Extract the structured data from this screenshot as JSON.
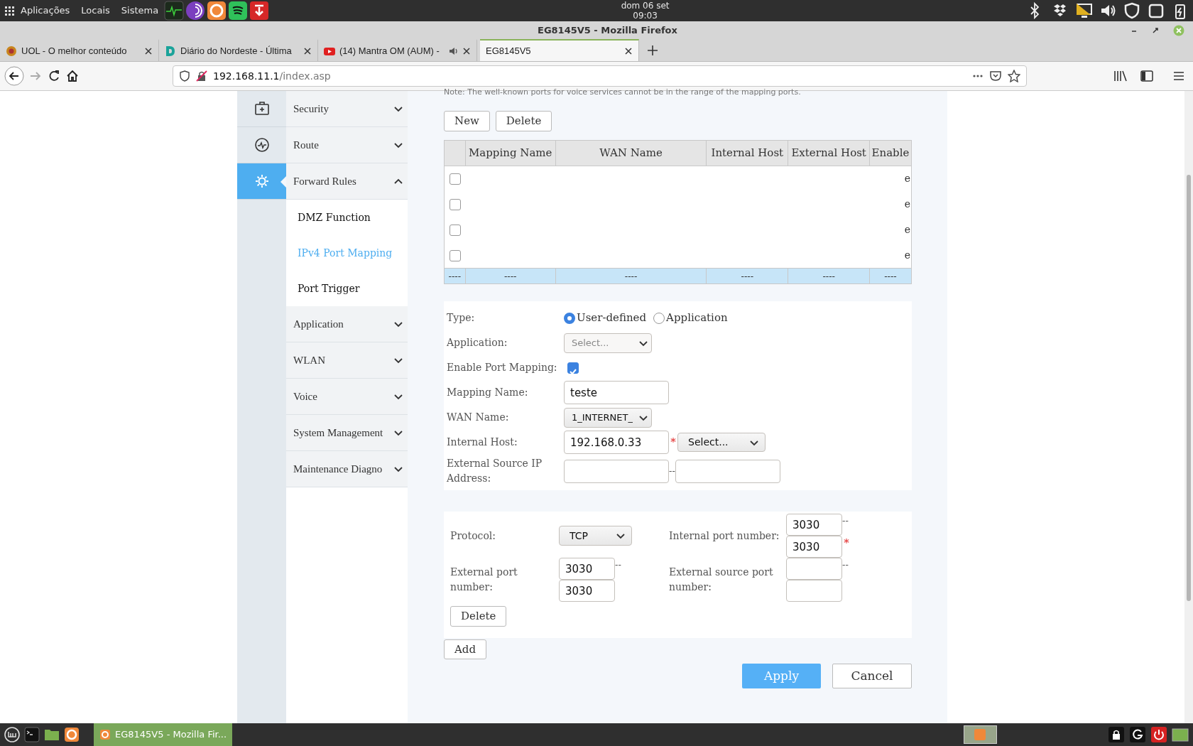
{
  "desktop_panel": {
    "menus": [
      "Aplicações",
      "Locais",
      "Sistema"
    ],
    "clock": [
      "dom 06 set",
      "09:03"
    ]
  },
  "window": {
    "title": "EG8145V5 - Mozilla Firefox"
  },
  "tabs": [
    {
      "label": "UOL - O melhor conteúdo",
      "selected": false,
      "audio": false
    },
    {
      "label": "Diário do Nordeste - Última",
      "selected": false,
      "audio": false
    },
    {
      "label": "(14) Mantra OM (AUM) -",
      "selected": false,
      "audio": true
    },
    {
      "label": "EG8145V5",
      "selected": true,
      "audio": false
    }
  ],
  "address_bar": {
    "host": "192.168.11.1",
    "path": "/index.asp"
  },
  "sidebar": {
    "items": [
      {
        "label": "Security",
        "expanded": false
      },
      {
        "label": "Route",
        "expanded": false
      },
      {
        "label": "Forward Rules",
        "expanded": true,
        "children": [
          {
            "label": "DMZ Function",
            "selected": false
          },
          {
            "label": "IPv4 Port Mapping",
            "selected": true
          },
          {
            "label": "Port Trigger",
            "selected": false
          }
        ]
      },
      {
        "label": "Application",
        "expanded": false
      },
      {
        "label": "WLAN",
        "expanded": false
      },
      {
        "label": "Voice",
        "expanded": false
      },
      {
        "label": "System Management",
        "expanded": false
      },
      {
        "label": "Maintenance Diagno",
        "expanded": false
      }
    ]
  },
  "note": "Note: The well-known ports for voice services cannot be in the range of the mapping ports.",
  "toolbar": [
    "New",
    "Delete"
  ],
  "table": {
    "columns": [
      "Mapping Name",
      "WAN Name",
      "Internal Host",
      "External Host",
      "Enable"
    ],
    "rows": [
      {
        "checked": false,
        "enable": "e"
      },
      {
        "checked": false,
        "enable": "e"
      },
      {
        "checked": false,
        "enable": "e"
      },
      {
        "checked": false,
        "enable": "e"
      }
    ],
    "footer": [
      "----",
      "----",
      "----",
      "----",
      "----",
      "----"
    ]
  },
  "form": [
    {
      "kind": "radio",
      "label": "Type:",
      "options": [
        {
          "label": "User-defined",
          "selected": true
        },
        {
          "label": "Application",
          "selected": false
        }
      ]
    },
    {
      "kind": "select",
      "label": "Application:",
      "value": "Select...",
      "disabled": true
    },
    {
      "kind": "checkbox",
      "label": "Enable Port Mapping:",
      "checked": true
    },
    {
      "kind": "text",
      "label": "Mapping Name:",
      "value": "teste"
    },
    {
      "kind": "select",
      "label": "WAN Name:",
      "value": "1_INTERNET_",
      "disabled": false
    },
    {
      "kind": "host",
      "label": "Internal Host:",
      "value": "192.168.0.33",
      "required": "*",
      "select": "Select..."
    },
    {
      "kind": "range",
      "label": "External Source IP Address:",
      "separator": "--"
    }
  ],
  "ports": {
    "protocol": {
      "label": "Protocol:",
      "value": "TCP"
    },
    "internal_port": {
      "label": "Internal port number:",
      "from": "3030",
      "separator": "--",
      "to": "3030",
      "required": "*"
    },
    "external_port": {
      "label": "External port number:",
      "from": "3030",
      "separator": "--",
      "to": "3030"
    },
    "external_source_port": {
      "label": "External source port number:",
      "separator": "--"
    },
    "delete_button": "Delete"
  },
  "add_button": "Add",
  "actions": [
    {
      "label": "Apply",
      "kind": "primary"
    },
    {
      "label": "Cancel",
      "kind": "secondary"
    }
  ],
  "taskbar": {
    "windows": [
      {
        "label": "EG8145V5 - Mozilla Fir...",
        "selected": true
      }
    ]
  }
}
